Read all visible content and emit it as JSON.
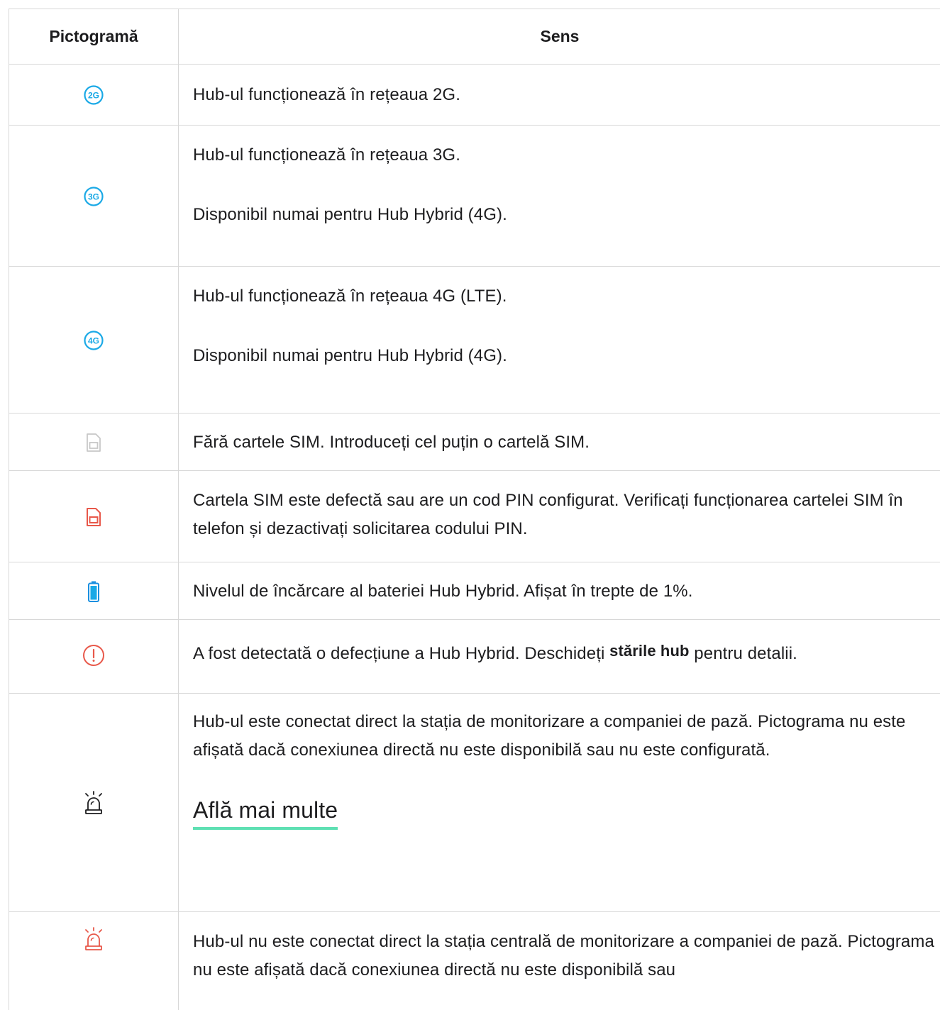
{
  "table": {
    "headers": {
      "icon": "Pictogramă",
      "meaning": "Sens"
    },
    "rows": [
      {
        "icon": "2g-network-icon",
        "lines": [
          "Hub-ul funcționează în rețeaua 2G."
        ]
      },
      {
        "icon": "3g-network-icon",
        "lines": [
          "Hub-ul funcționează în rețeaua 3G.",
          "Disponibil numai pentru Hub Hybrid (4G)."
        ]
      },
      {
        "icon": "4g-network-icon",
        "lines": [
          "Hub-ul funcționează în rețeaua 4G (LTE).",
          "Disponibil numai pentru Hub Hybrid (4G)."
        ]
      },
      {
        "icon": "sim-card-missing-icon",
        "lines": [
          "Fără cartele SIM. Introduceți cel puțin o cartelă SIM."
        ]
      },
      {
        "icon": "sim-card-error-icon",
        "lines": [
          "Cartela SIM este defectă sau are un cod PIN configurat. Verificați funcționarea cartelei SIM în telefon și dezactivați solicitarea codului PIN."
        ]
      },
      {
        "icon": "battery-icon",
        "lines": [
          "Nivelul de încărcare al bateriei Hub Hybrid. Afișat în trepte de 1%."
        ]
      },
      {
        "icon": "malfunction-alert-icon",
        "text_before": "A fost detectată o defecțiune a Hub Hybrid. Deschideți ",
        "bold": "stările hub",
        "text_after": " pentru detalii."
      },
      {
        "icon": "monitoring-station-connected-icon",
        "lines": [
          "Hub-ul este conectat direct la stația de monitorizare a companiei de pază. Pictograma nu este afișată dacă conexiunea directă nu este disponibilă sau nu este configurată."
        ],
        "link": "Află mai multe"
      },
      {
        "icon": "monitoring-station-disconnected-icon",
        "lines": [
          "Hub-ul nu este conectat direct la stația centrală de monitorizare a companiei de pază. Pictograma nu este afișată dacă conexiunea directă nu este disponibilă sau"
        ]
      }
    ]
  },
  "colors": {
    "network_blue": "#1aa9e6",
    "sim_gray": "#c8c8c8",
    "alert_red": "#e8584a",
    "battery_blue": "#1a8fe0",
    "link_underline": "#5ee0b3",
    "border": "#d8d8d8"
  }
}
